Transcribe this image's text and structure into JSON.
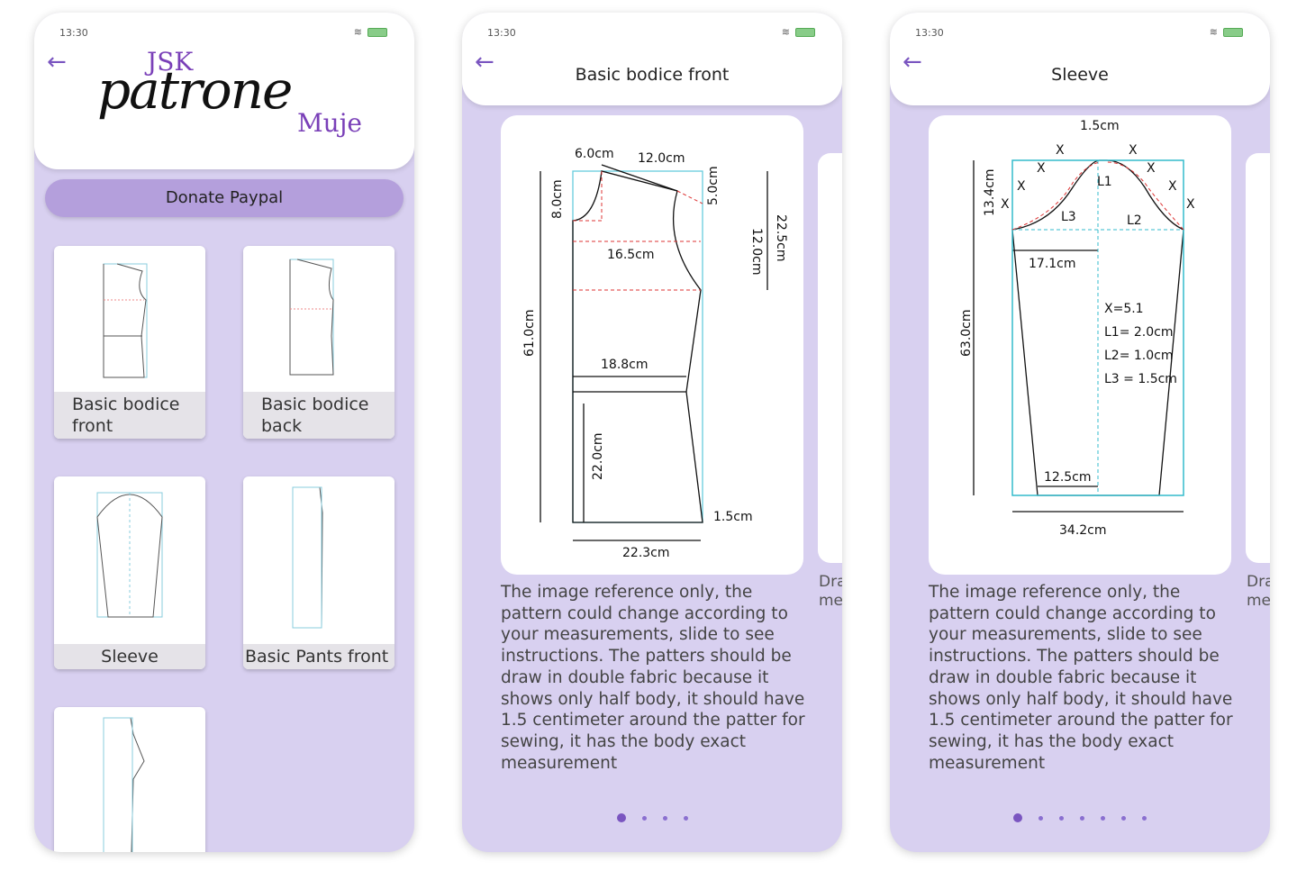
{
  "status": {
    "time": "13:30",
    "icons": [
      "wifi-icon",
      "battery-charging-icon"
    ]
  },
  "phone1": {
    "logo": {
      "top": "JSK",
      "script": "patrone",
      "bottom": "Muje"
    },
    "donate_label": "Donate Paypal",
    "tiles": [
      {
        "label": "Basic bodice front"
      },
      {
        "label": "Basic bodice back"
      },
      {
        "label": "Sleeve"
      },
      {
        "label": "Basic Pants front"
      },
      {
        "label": ""
      }
    ]
  },
  "phone2": {
    "title": "Basic bodice front",
    "diagram_labels": [
      "6.0cm",
      "12.0cm",
      "5.0cm",
      "8.0cm",
      "12.0cm",
      "22.5cm",
      "16.5cm",
      "61.0cm",
      "18.8cm",
      "22.0cm",
      "1.5cm",
      "22.3cm"
    ],
    "peek_text": [
      "Dra",
      "me"
    ],
    "description": "The image reference only, the pattern could change according to your measurements, slide to see instructions. The patters should be draw in double fabric because it shows only half body, it should have 1.5 centimeter around the patter for sewing, it has the body exact measurement",
    "page_count": 4,
    "current_page": 1
  },
  "phone3": {
    "title": "Sleeve",
    "diagram_labels": [
      "1.5cm",
      "13.4cm",
      "L1",
      "L3",
      "L2",
      "17.1cm",
      "X=5.1",
      "L1= 2.0cm",
      "L2= 1.0cm",
      "L3 = 1.5cm",
      "63.0cm",
      "12.5cm",
      "34.2cm",
      "X"
    ],
    "peek_text": [
      "Dra",
      "me"
    ],
    "description": "The image reference only, the pattern could change according to your measurements, slide to see instructions. The patters should be draw in double fabric because it shows only half body, it should have 1.5 centimeter around the patter for sewing, it has the body exact measurement",
    "page_count": 7,
    "current_page": 1
  },
  "colors": {
    "accent": "#7a55c0",
    "background": "#d8d0f0",
    "button": "#b49fdc"
  }
}
